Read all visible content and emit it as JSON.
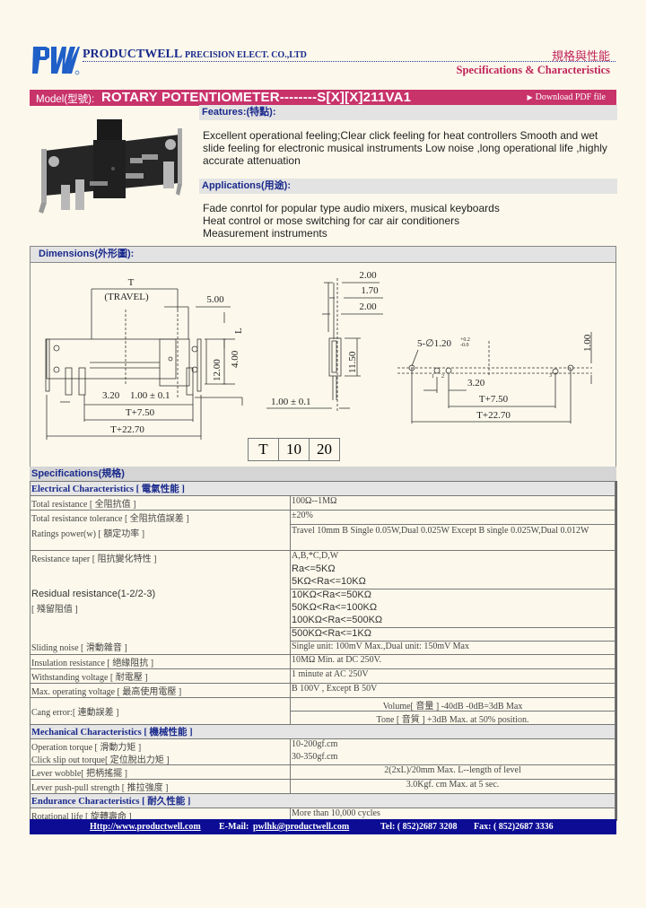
{
  "header": {
    "logo_text": "PWL",
    "company_main": "PRODUCTWELL",
    "company_rest": "PRECISION ELECT. CO.,LTD",
    "title_cn": "規格與性能",
    "title_en": "Specifications & Characteristics"
  },
  "model_bar": {
    "label": "Model(型號):",
    "name": "ROTARY  POTENTIOMETER--------S[X][X]211VA1",
    "download_label": "Download PDF file",
    "color": "#c8336a"
  },
  "features": {
    "heading": "Features:(特點):",
    "text": "Excellent operational feeling;Clear click feeling for heat controllers Smooth and wet slide feeling for electronic musical instruments Low noise ,long operational life ,highly accurate attenuation"
  },
  "applications": {
    "heading": "Applications(用途):",
    "lines": [
      "Fade conrtol for popular type audio mixers, musical keyboards",
      "Heat control or mose switching for car air conditioners",
      "Measurement instruments"
    ]
  },
  "dimensions": {
    "heading": "Dimensions(外形圖):",
    "front_labels": {
      "t": "T",
      "travel": "(TRAVEL)",
      "d500": "5.00",
      "L": "L",
      "d1200": "12.00",
      "d400": "4.00",
      "d320": "3.20",
      "tol": "1.00 ± 0.1",
      "t750": "T+7.50",
      "t2270": "T+22.70"
    },
    "side_labels": {
      "d200a": "2.00",
      "d170": "1.70",
      "d200b": "2.00",
      "d1150": "11.50",
      "tol": "1.00 ± 0.1"
    },
    "pcb_labels": {
      "holes": "5-∅1.20",
      "hole_tol_up": "+0.2",
      "hole_tol_down": "-0.0",
      "d100": "1.00",
      "d320": "3.20",
      "t750": "T+7.50",
      "t2270": "T+22.70",
      "pin1": "1",
      "pin2": "2",
      "pin3": "3"
    },
    "travel_table": [
      "T",
      "10",
      "20"
    ]
  },
  "specifications": {
    "heading": "Specifications(規格)",
    "electrical": {
      "heading": "Electrical Characteristics [ 電氣性能 ]",
      "total_resistance": {
        "label": "Total resistance [ 全阻抗值 ]",
        "value": "100Ω--1MΩ"
      },
      "tolerance": {
        "label": "Total resistance tolerance [ 全阻抗值誤差 ]",
        "value": "±20%"
      },
      "ratings": {
        "label": "Ratings power(w) [ 額定功率 ]",
        "value": "Travel 10mm    B  Single 0.05W,Dual 0.025W      Except B  single 0.025W,Dual 0.012W"
      },
      "taper": {
        "label": "Resistance taper [ 阻抗變化特性 ]",
        "value": "A,B,*C,D,W"
      },
      "residual": {
        "label": "Residual resistance(1-2/2-3)",
        "label_cn": "[ 殘留阻值 ]",
        "values": [
          "Ra<=5KΩ",
          "5KΩ<Ra<=10KΩ",
          "10KΩ<Ra<=50KΩ",
          "50KΩ<Ra<=100KΩ",
          "100KΩ<Ra<=500KΩ",
          "500KΩ<Ra<=1KΩ"
        ]
      },
      "sliding_noise": {
        "label": "Sliding noise [ 滑動雜音 ]",
        "value": "Single unit: 100mV Max.,Dual unit: 150mV Max"
      },
      "insulation": {
        "label": "Insulation resistance [ 絕緣阻抗 ]",
        "value": "10MΩ Min. at DC 250V."
      },
      "withstanding": {
        "label": "Withstanding voltage [ 耐電壓 ]",
        "value": "1 minute at AC 250V"
      },
      "max_voltage": {
        "label": "Max. operating voltage [ 最高使用電壓 ]",
        "value": "B 100V   , Except B  50V"
      },
      "gang_error": {
        "label": "Cang error:[ 連動誤差 ]",
        "volume": "Volume[ 音量 ]       -40dB  -0dB=3dB Max",
        "tone": "Tone [ 音質 ]      +3dB Max. at 50% position."
      }
    },
    "mechanical": {
      "heading": "Mechanical Characteristics [ 機械性能 ]",
      "operation_torque": {
        "label": "Operation torque [ 滑動力矩 ]",
        "value": "10-200gf.cm"
      },
      "click_torque": {
        "label": "Click slip out torque[ 定位脫出力矩 ]",
        "value": "30-350gf.cm"
      },
      "wobble": {
        "label": "Lever wobble[ 把柄搖擺 ]",
        "value": "2(2xL)/20mm Max. L--length of level"
      },
      "push_pull": {
        "label": "Lever push-pull strength [ 推拉強度 ]",
        "value": "3.0Kgf. cm  Max. at 5 sec."
      }
    },
    "endurance": {
      "heading": "Endurance Characteristics [ 耐久性能 ]",
      "rotational_life": {
        "label": "Rotational life [ 旋轉壽命 ]",
        "value": "More than 10,000 cycles"
      }
    }
  },
  "footer": {
    "website": "Http://www.productwell.com",
    "email_label": "E-Mail:",
    "email": "pwlhk@productwell.com",
    "tel": "Tel: ( 852)2687 3208",
    "fax": "Fax: ( 852)2687 3336",
    "color": "#0c0c94"
  }
}
